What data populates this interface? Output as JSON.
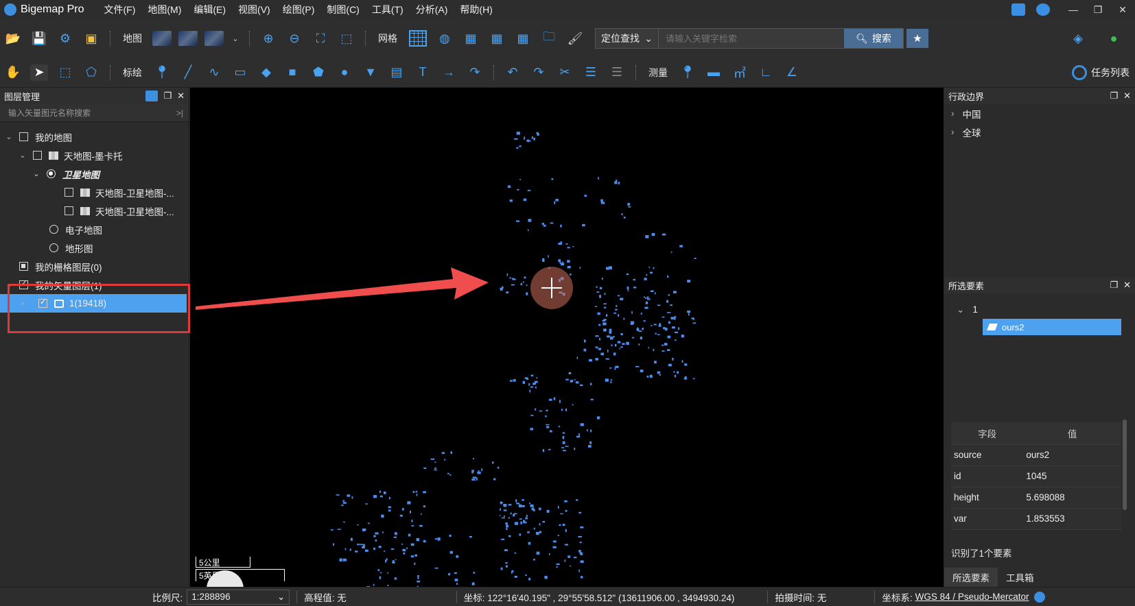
{
  "app": {
    "name": "Bigemap Pro"
  },
  "menu": [
    "文件(F)",
    "地图(M)",
    "编辑(E)",
    "视图(V)",
    "绘图(P)",
    "制图(C)",
    "工具(T)",
    "分析(A)",
    "帮助(H)"
  ],
  "toolbar1": {
    "map_label": "地图",
    "grid_label": "网格",
    "search_mode": "定位查找",
    "search_placeholder": "请输入关键字检索",
    "search_button": "搜索"
  },
  "toolbar2": {
    "annotate_label": "标绘",
    "measure_label": "测量",
    "task_list": "任务列表"
  },
  "layer_panel": {
    "title": "图层管理",
    "search_placeholder": "输入矢量图元名称搜索",
    "tree": [
      {
        "label": "我的地图"
      },
      {
        "label": "天地图-墨卡托"
      },
      {
        "label": "卫星地图"
      },
      {
        "label": "天地图-卫星地图-..."
      },
      {
        "label": "天地图-卫星地图-..."
      },
      {
        "label": "电子地图"
      },
      {
        "label": "地形图"
      },
      {
        "label": "我的栅格图层(0)"
      },
      {
        "label": "我的矢量图层(1)"
      },
      {
        "label": "1(19418)"
      }
    ]
  },
  "map": {
    "scale_km": "5公里",
    "scale_mi": "5英里",
    "feature_color": "#4c8ef0"
  },
  "admin_panel": {
    "title": "行政边界",
    "items": [
      "中国",
      "全球"
    ]
  },
  "selected_panel": {
    "title": "所选要素",
    "group": "1",
    "item": "ours2",
    "columns": [
      "字段",
      "值"
    ],
    "rows": [
      {
        "field": "source",
        "value": "ours2"
      },
      {
        "field": "id",
        "value": "1045"
      },
      {
        "field": "height",
        "value": "5.698088"
      },
      {
        "field": "var",
        "value": "1.853553"
      }
    ],
    "status": "识别了1个要素",
    "tabs": [
      "所选要素",
      "工具箱"
    ]
  },
  "statusbar": {
    "scale_label": "比例尺:",
    "scale_value": "1:288896",
    "elevation": "高程值: 无",
    "coords": "坐标: 122°16'40.195\" , 29°55'58.512\"   (13611906.00 , 3494930.24)",
    "capture_time": "拍摄时间: 无",
    "crs_label": "坐标系:",
    "crs_value": "WGS 84 / Pseudo-Mercator"
  }
}
